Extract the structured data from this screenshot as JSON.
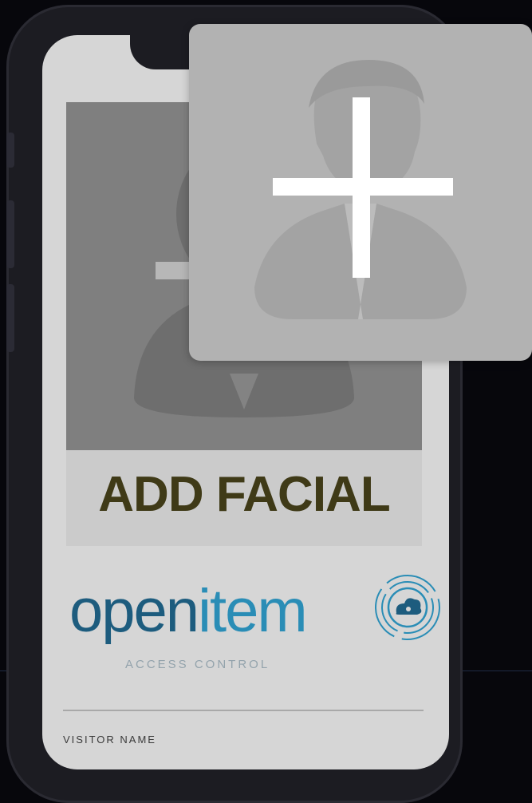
{
  "screen": {
    "add_facial_label": "ADD FACIAL",
    "visitor_name_label": "VISITOR NAME"
  },
  "logo": {
    "brand_part1": "open",
    "brand_part2": "item",
    "tagline": "ACCESS CONTROL"
  },
  "overlay": {
    "icon": "add-person-icon"
  },
  "colors": {
    "add_facial_text": "#3f3a17",
    "brand_dark": "#1d5c7e",
    "brand_light": "#2a8db6",
    "tile_bg": "#b2b2b2"
  }
}
